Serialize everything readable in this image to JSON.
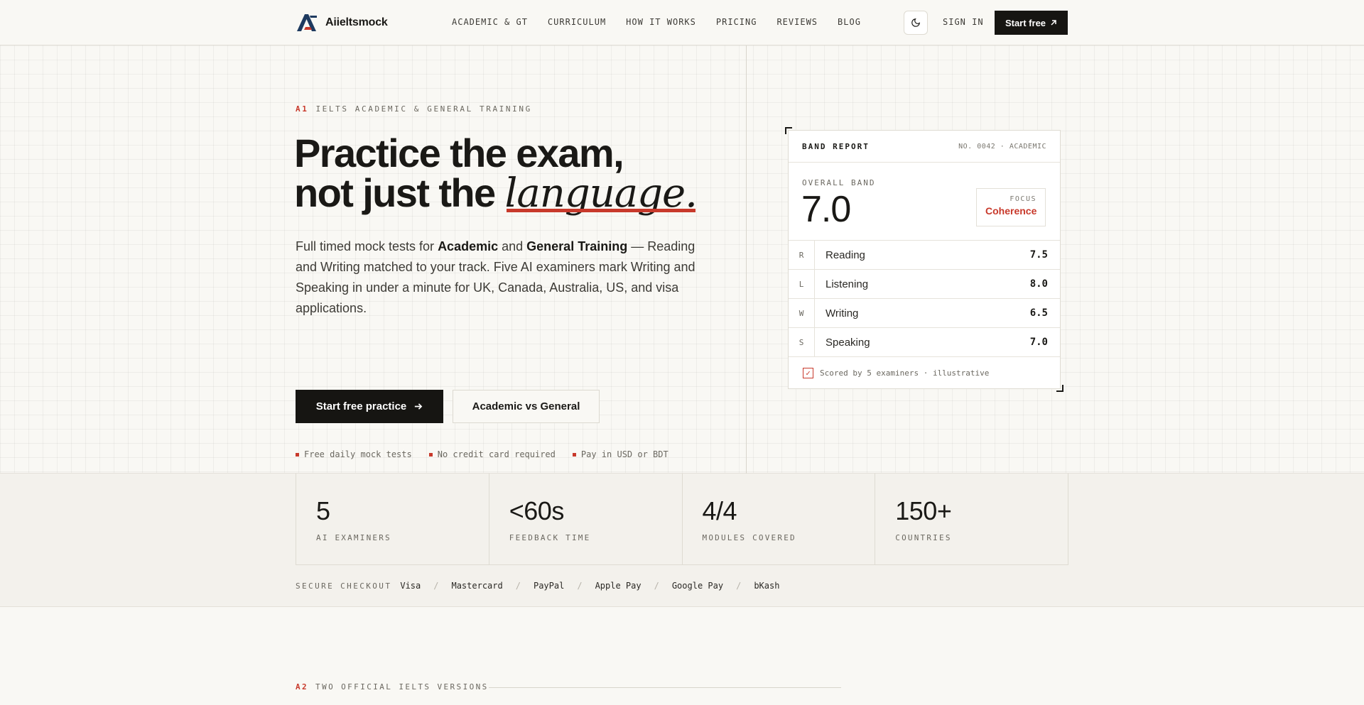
{
  "brand": {
    "name": "Aiieltsmock"
  },
  "nav": {
    "items": [
      "ACADEMIC & GT",
      "CURRICULUM",
      "HOW IT WORKS",
      "PRICING",
      "REVIEWS",
      "BLOG"
    ],
    "sign_in": "SIGN IN",
    "start_free": "Start free"
  },
  "hero": {
    "eyebrow_code": "A1",
    "eyebrow_text": "IELTS ACADEMIC & GENERAL TRAINING",
    "headline_line1": "Practice the exam,",
    "headline_line2_pre": "not just the ",
    "headline_emphasis": "language.",
    "lead_pre": "Full timed mock tests for ",
    "lead_b1": "Academic",
    "lead_mid": " and ",
    "lead_b2": "General Training",
    "lead_post": " — Reading and Writing matched to your track. Five AI examiners mark Writing and Speaking in under a minute for UK, Canada, Australia, US, and visa applications.",
    "cta_primary": "Start free practice",
    "cta_secondary": "Academic vs General",
    "perks": [
      "Free daily mock tests",
      "No credit card required",
      "Pay in USD or BDT"
    ]
  },
  "report": {
    "title": "BAND REPORT",
    "number": "NO. 0042 · ACADEMIC",
    "overall_label": "OVERALL BAND",
    "overall_value": "7.0",
    "focus_label": "FOCUS",
    "focus_value": "Coherence",
    "scores": [
      {
        "code": "R",
        "name": "Reading",
        "value": "7.5"
      },
      {
        "code": "L",
        "name": "Listening",
        "value": "8.0"
      },
      {
        "code": "W",
        "name": "Writing",
        "value": "6.5"
      },
      {
        "code": "S",
        "name": "Speaking",
        "value": "7.0"
      }
    ],
    "footer": "Scored by 5 examiners · illustrative"
  },
  "stats": [
    {
      "value": "5",
      "label": "AI EXAMINERS"
    },
    {
      "value": "<60s",
      "label": "FEEDBACK TIME"
    },
    {
      "value": "4/4",
      "label": "MODULES COVERED"
    },
    {
      "value": "150+",
      "label": "COUNTRIES"
    }
  ],
  "checkout": {
    "label": "SECURE CHECKOUT",
    "methods": [
      "Visa",
      "Mastercard",
      "PayPal",
      "Apple Pay",
      "Google Pay",
      "bKash"
    ]
  },
  "next_section": {
    "code": "A2",
    "title": "TWO OFFICIAL IELTS VERSIONS"
  },
  "colors": {
    "accent": "#c8392b",
    "ink": "#161512",
    "background": "#f9f8f4",
    "logo_blue": "#1e3a5f"
  }
}
